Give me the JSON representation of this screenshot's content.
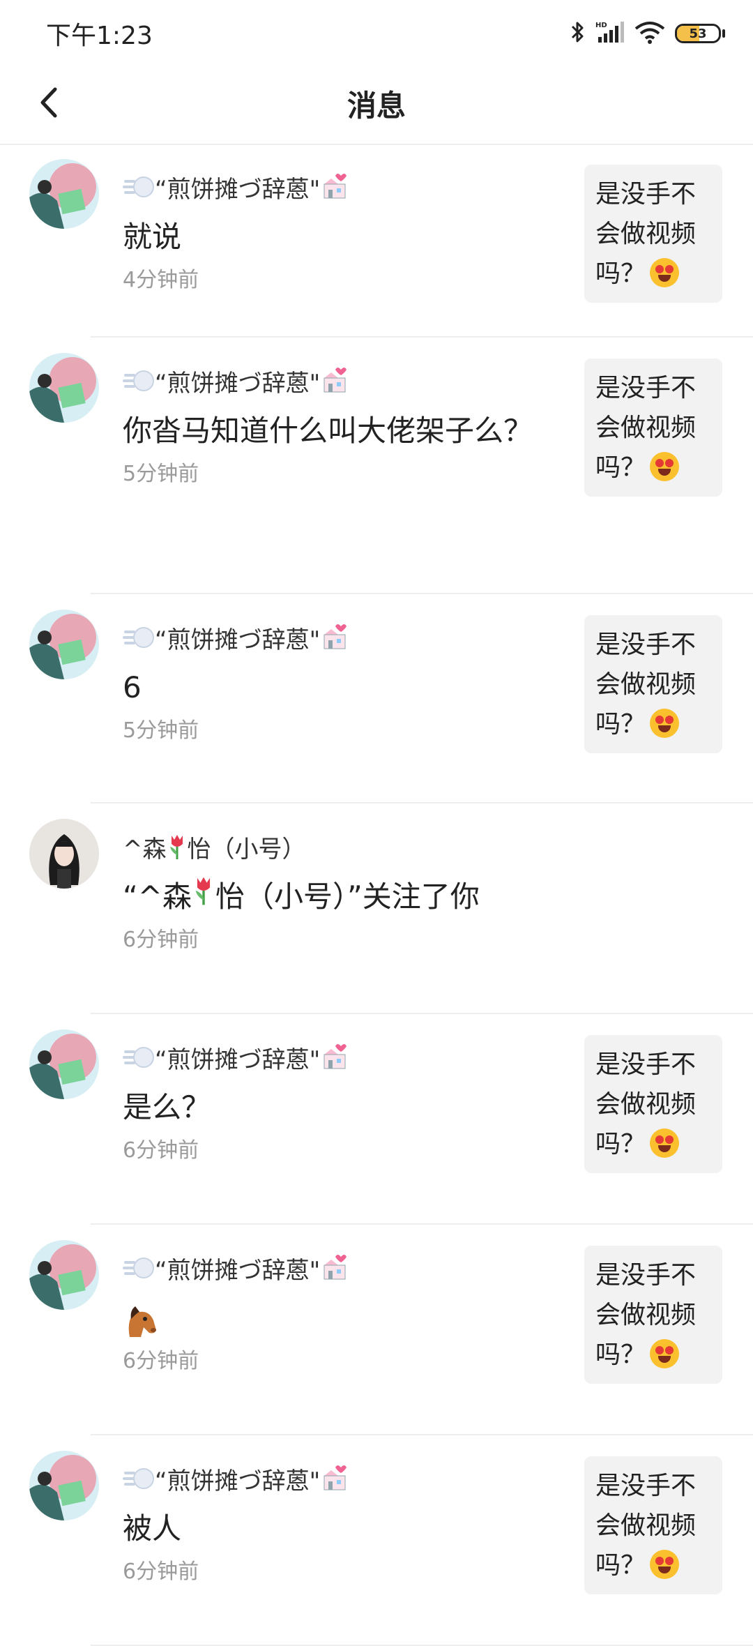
{
  "status_bar": {
    "time": "下午1:23",
    "battery": "53",
    "battery_level": 0.53,
    "icons": [
      "bluetooth-icon",
      "hd-signal-icon",
      "wifi-icon",
      "battery-icon"
    ]
  },
  "nav": {
    "title": "消息",
    "back_icon": "chevron-left-icon"
  },
  "colors": {
    "timestamp": "#9a9a9a",
    "divider": "#eeeeee",
    "preview_bg": "#f2f2f2",
    "battery_fill": "#f5c04a"
  },
  "messages": [
    {
      "user": "“煎饼摊づ辞蒽\"",
      "text": "就说",
      "time": "4分钟前",
      "preview": "是没手不会做视频吗？"
    },
    {
      "user": "“煎饼摊づ辞蒽\"",
      "text": "你沓马知道什么叫大佬架子么？",
      "time": "5分钟前",
      "preview": "是没手不会做视频吗？"
    },
    {
      "user": "“煎饼摊づ辞蒽\"",
      "text": "6",
      "time": "5分钟前",
      "preview": "是没手不会做视频吗？"
    },
    {
      "user_prefix": "^森",
      "user_suffix": "怡（小号）",
      "text_prefix": "“^森",
      "text_suffix": "怡（小号）”关注了你",
      "time": "6分钟前"
    },
    {
      "user": "“煎饼摊づ辞蒽\"",
      "text": "是么？",
      "time": "6分钟前",
      "preview": "是没手不会做视频吗？"
    },
    {
      "user": "“煎饼摊づ辞蒽\"",
      "text_emoji": "horse-face-emoji",
      "time": "6分钟前",
      "preview": "是没手不会做视频吗？"
    },
    {
      "user": "“煎饼摊づ辞蒽\"",
      "text": "被人",
      "time": "6分钟前",
      "preview": "是没手不会做视频吗？"
    }
  ]
}
